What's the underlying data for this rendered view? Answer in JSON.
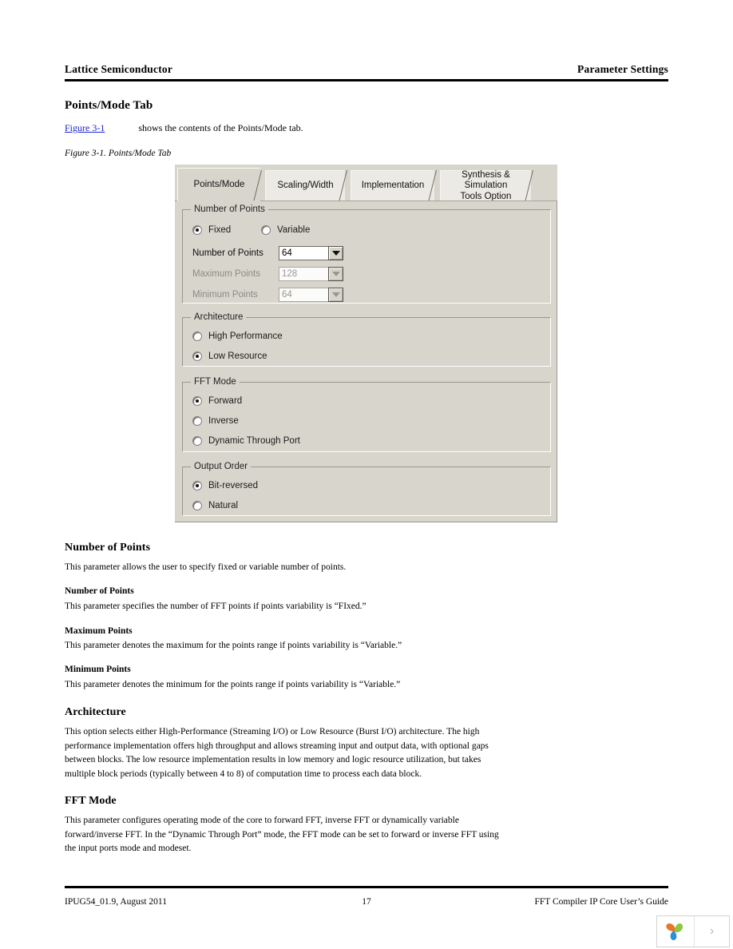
{
  "header": {
    "left": "Lattice Semiconductor",
    "right": "Parameter Settings"
  },
  "section": {
    "title": "Points/Mode Tab",
    "intro_link": "Figure 3-1",
    "intro_text": "shows the contents of the Points/Mode tab.",
    "figure_caption": "Figure 3-1. Points/Mode Tab"
  },
  "dialog": {
    "tabs": [
      {
        "label": "Points/Mode",
        "active": true
      },
      {
        "label": "Scaling/Width",
        "active": false
      },
      {
        "label": "Implementation",
        "active": false
      },
      {
        "label": "Synthesis & Simulation\nTools Option",
        "active": false
      }
    ],
    "number_of_points_group": {
      "legend": "Number of Points",
      "variability": [
        {
          "label": "Fixed",
          "selected": true
        },
        {
          "label": "Variable",
          "selected": false
        }
      ],
      "fields": [
        {
          "label": "Number of Points",
          "value": "64",
          "disabled": false
        },
        {
          "label": "Maximum Points",
          "value": "128",
          "disabled": true
        },
        {
          "label": "Minimum Points",
          "value": "64",
          "disabled": true
        }
      ]
    },
    "architecture_group": {
      "legend": "Architecture",
      "options": [
        {
          "label": "High Performance",
          "selected": false
        },
        {
          "label": "Low Resource",
          "selected": true
        }
      ]
    },
    "fft_mode_group": {
      "legend": "FFT Mode",
      "options": [
        {
          "label": "Forward",
          "selected": true
        },
        {
          "label": "Inverse",
          "selected": false
        },
        {
          "label": "Dynamic Through Port",
          "selected": false
        }
      ]
    },
    "output_order_group": {
      "legend": "Output Order",
      "options": [
        {
          "label": "Bit-reversed",
          "selected": true
        },
        {
          "label": "Natural",
          "selected": false
        }
      ]
    }
  },
  "body": {
    "number_of_points_heading": "Number of Points",
    "number_of_points_intro": "This parameter allows the user to specify fixed or variable number of points.",
    "sub_number_of_points_heading": "Number of Points",
    "sub_number_of_points_text": "This parameter specifies the number of FFT points if points variability is “FIxed.”",
    "sub_maximum_points_heading": "Maximum Points",
    "sub_maximum_points_text": "This parameter denotes the maximum for the points range if points variability is “Variable.”",
    "sub_minimum_points_heading": "Minimum Points",
    "sub_minimum_points_text": "This parameter denotes the minimum for the points range if points variability is “Variable.”",
    "architecture_heading": "Architecture",
    "architecture_text": "This option selects either High-Performance (Streaming I/O) or Low Resource (Burst I/O) architecture. The high performance implementation offers high throughput and allows streaming input and output data, with optional gaps between blocks. The low resource implementation results in low memory and logic resource utilization, but takes multiple block periods (typically between 4 to 8) of computation time to process each data block.",
    "fft_mode_heading": "FFT Mode",
    "fft_mode_text": "This parameter configures operating mode of the core to forward FFT, inverse FFT or dynamically variable forward/inverse FFT. In the “Dynamic Through Port” mode, the FFT mode can be set to forward or inverse FFT using the input ports mode and modeset."
  },
  "footer": {
    "left": "IPUG54_01.9, August 2011",
    "center": "17",
    "right": "FFT Compiler IP Core User’s Guide"
  },
  "float_widget": {
    "logo_name": "three-petal-flower-logo",
    "next_label": "›"
  },
  "colors": {
    "link": "#1a22cc",
    "dialog_face": "#d8d5cc",
    "dialog_tab_inactive": "#eceae4",
    "disabled_text": "#8d8a84",
    "logo_orange": "#e8762c",
    "logo_green": "#8dc63f",
    "logo_blue": "#2a8fd4"
  }
}
